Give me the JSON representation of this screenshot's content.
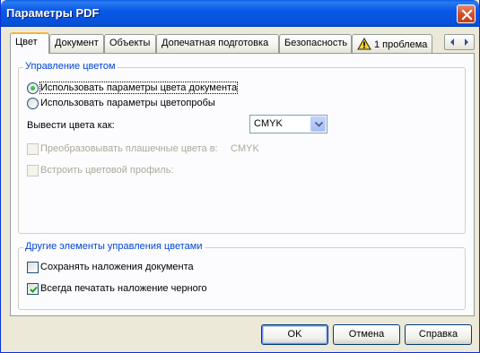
{
  "window": {
    "title": "Параметры PDF"
  },
  "tabs": [
    {
      "label": "Цвет",
      "active": true
    },
    {
      "label": "Документ",
      "active": false
    },
    {
      "label": "Объекты",
      "active": false
    },
    {
      "label": "Допечатная подготовка",
      "active": false
    },
    {
      "label": "Безопасность",
      "active": false
    },
    {
      "label": "1 проблема",
      "active": false,
      "icon": "warning-icon"
    }
  ],
  "color_management": {
    "group_label": "Управление цветом",
    "radio_document": {
      "label": "Использовать параметры цвета документа",
      "checked": true
    },
    "radio_proof": {
      "label": "Использовать параметры цветопробы",
      "checked": false
    },
    "output_label": "Вывести цвета как:",
    "output_value": "CMYK",
    "convert_spot": {
      "label": "Преобразовывать плашечные цвета в:",
      "value": "CMYK",
      "checked": false,
      "enabled": false
    },
    "embed_profile": {
      "label": "Встроить цветовой профиль:",
      "checked": false,
      "enabled": false
    }
  },
  "other": {
    "group_label": "Другие элементы управления цветами",
    "preserve_overprint": {
      "label": "Сохранять наложения документа",
      "checked": false
    },
    "black_overprint": {
      "label": "Всегда печатать наложение черного",
      "checked": true
    }
  },
  "buttons": {
    "ok": "OK",
    "cancel": "Отмена",
    "help": "Справка"
  },
  "colors": {
    "title_bar": "#0958e6",
    "group_label": "#0046d5",
    "active_tab_accent": "#f5b444"
  }
}
